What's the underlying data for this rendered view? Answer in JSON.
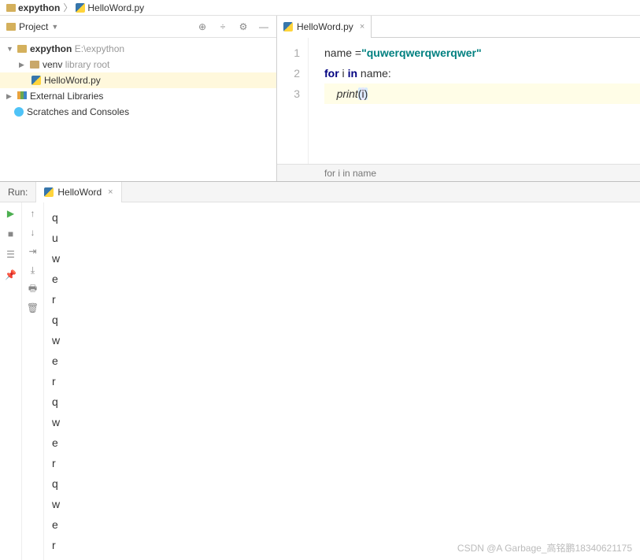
{
  "breadcrumb": {
    "project": "expython",
    "file": "HelloWord.py"
  },
  "project_panel": {
    "title": "Project",
    "root": {
      "name": "expython",
      "path": "E:\\expython"
    },
    "venv": {
      "name": "venv",
      "suffix": "library root"
    },
    "file": "HelloWord.py",
    "external": "External Libraries",
    "scratches": "Scratches and Consoles"
  },
  "editor": {
    "tab": "HelloWord.py",
    "gutter": [
      "1",
      "2",
      "3"
    ],
    "line1": {
      "a": "name =",
      "str": "\"quwerqwerqwerqwer\""
    },
    "line2": {
      "a": "for",
      "b": " i ",
      "c": "in",
      "d": " name:"
    },
    "line3": {
      "indent": "    ",
      "fn": "print",
      "lp": "(",
      "arg": "i",
      "rp": ")"
    },
    "status": "for i in name"
  },
  "run": {
    "label": "Run:",
    "tab": "HelloWord",
    "output": [
      "q",
      "u",
      "w",
      "e",
      "r",
      "q",
      "w",
      "e",
      "r",
      "q",
      "w",
      "e",
      "r",
      "q",
      "w",
      "e",
      "r"
    ]
  },
  "watermark": "CSDN @A Garbage_高铭鹏18340621175"
}
